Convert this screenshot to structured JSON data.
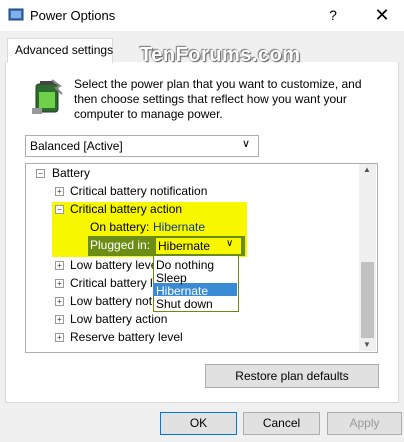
{
  "window": {
    "title": "Power Options",
    "help_glyph": "?",
    "close_glyph": "✕"
  },
  "tab": {
    "label": "Advanced settings"
  },
  "watermark": "TenForums.com",
  "description": "Select the power plan that you want to customize, and then choose settings that reflect how you want your computer to manage power.",
  "plan": {
    "selected": "Balanced [Active]"
  },
  "tree": {
    "root": "Battery",
    "items": [
      "Critical battery notification",
      "Critical battery action",
      "Low battery leve",
      "Critical battery l",
      "Low battery not",
      "Low battery action",
      "Reserve battery level"
    ],
    "on_battery_label": "On battery:",
    "on_battery_value": "Hibernate",
    "plugged_in_label": "Plugged in:",
    "plugged_in_value": "Hibernate"
  },
  "dropdown": {
    "options": [
      "Do nothing",
      "Sleep",
      "Hibernate",
      "Shut down"
    ],
    "selected": "Hibernate"
  },
  "buttons": {
    "restore": "Restore plan defaults",
    "ok": "OK",
    "cancel": "Cancel",
    "apply": "Apply"
  },
  "colors": {
    "highlight": "#f7f700",
    "plugged_bg": "#6c8e14",
    "selection": "#3a8bd5"
  }
}
